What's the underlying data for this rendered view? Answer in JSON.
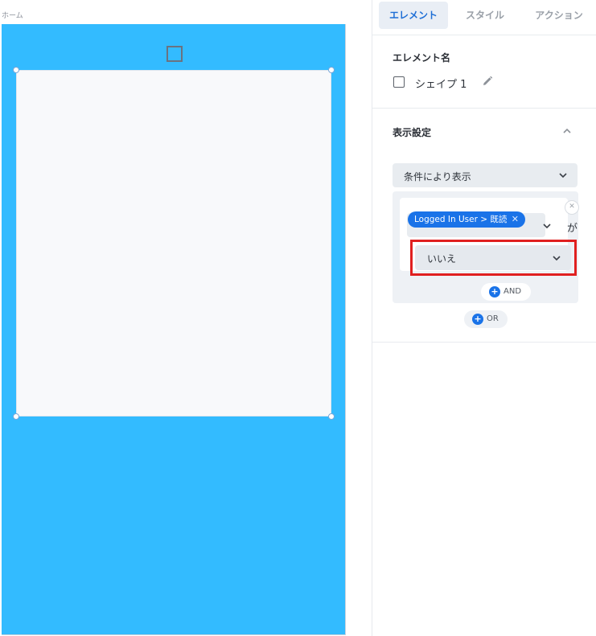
{
  "canvas": {
    "screen_label": "ホーム",
    "background_color": "#33bbff"
  },
  "panel": {
    "tabs": [
      {
        "label": "エレメント",
        "active": true
      },
      {
        "label": "スタイル",
        "active": false
      },
      {
        "label": "アクション",
        "active": false
      }
    ],
    "element_name": {
      "title": "エレメント名",
      "value": "シェイプ 1"
    },
    "visibility": {
      "title": "表示設定",
      "mode": "条件により表示",
      "condition": {
        "field": "Logged In User > 既読",
        "connector": "が",
        "value": "いいえ"
      },
      "and_label": "AND",
      "or_label": "OR"
    }
  },
  "colors": {
    "accent": "#1a73e8",
    "highlight": "#e02020"
  }
}
